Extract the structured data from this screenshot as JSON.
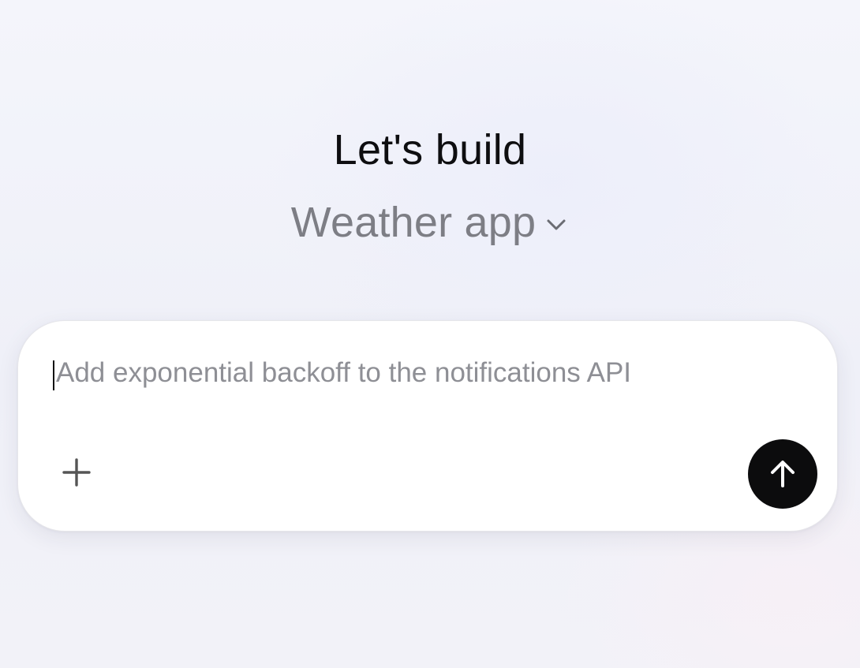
{
  "hero": {
    "title": "Let's build",
    "project_selector": {
      "selected": "Weather app",
      "icon": "chevron-down-icon"
    }
  },
  "composer": {
    "input": {
      "value": "",
      "placeholder": "Add exponential backoff to the notifications API"
    },
    "add_button_icon": "plus-icon",
    "send_button_icon": "arrow-up-icon"
  },
  "colors": {
    "title": "#0e0e10",
    "selector_text": "#7d7e85",
    "placeholder": "#8e8f95",
    "send_button_bg": "#0c0c0d",
    "composer_bg": "#ffffff"
  }
}
